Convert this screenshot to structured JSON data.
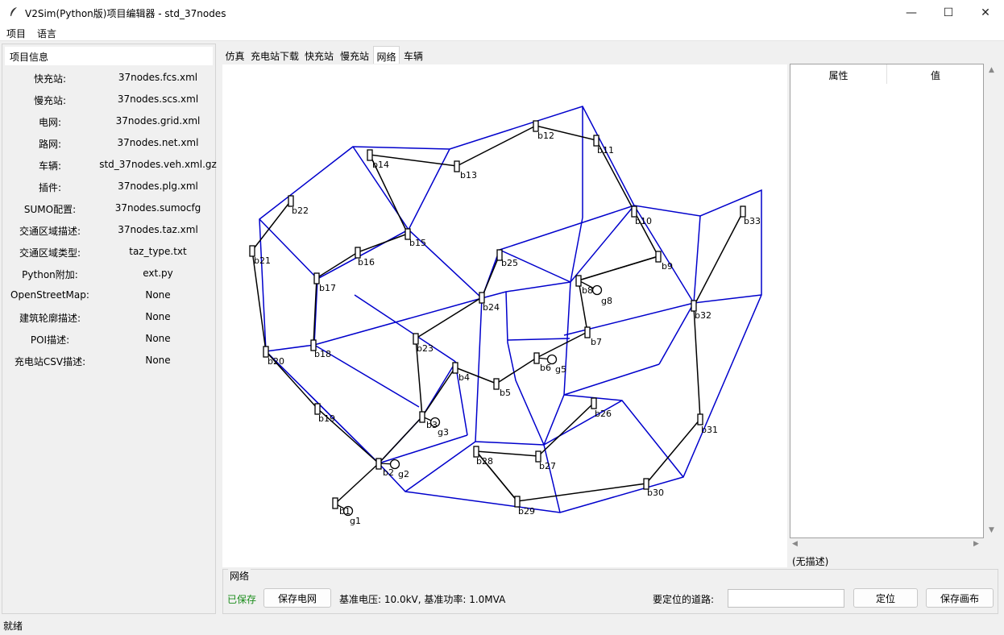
{
  "window": {
    "title": "V2Sim(Python版)项目编辑器 - std_37nodes",
    "minimize": "—",
    "maximize": "☐",
    "close": "✕"
  },
  "menu": [
    "项目",
    "语言"
  ],
  "project_info": {
    "header": "项目信息",
    "rows": [
      {
        "key": "快充站:",
        "value": "37nodes.fcs.xml"
      },
      {
        "key": "慢充站:",
        "value": "37nodes.scs.xml"
      },
      {
        "key": "电网:",
        "value": "37nodes.grid.xml"
      },
      {
        "key": "路网:",
        "value": "37nodes.net.xml"
      },
      {
        "key": "车辆:",
        "value": "std_37nodes.veh.xml.gz"
      },
      {
        "key": "插件:",
        "value": "37nodes.plg.xml"
      },
      {
        "key": "SUMO配置:",
        "value": "37nodes.sumocfg"
      },
      {
        "key": "交通区域描述:",
        "value": "37nodes.taz.xml"
      },
      {
        "key": "交通区域类型:",
        "value": "taz_type.txt"
      },
      {
        "key": "Python附加:",
        "value": "ext.py"
      },
      {
        "key": "OpenStreetMap:",
        "value": "None"
      },
      {
        "key": "建筑轮廓描述:",
        "value": "None"
      },
      {
        "key": "POI描述:",
        "value": "None"
      },
      {
        "key": "充电站CSV描述:",
        "value": "None"
      }
    ]
  },
  "tabs": [
    "仿真",
    "充电站下载",
    "快充站",
    "慢充站",
    "网络",
    "车辆"
  ],
  "active_tab": "网络",
  "properties": {
    "col_attr": "属性",
    "col_value": "值",
    "description": "(无描述)"
  },
  "network_group": {
    "label": "网络",
    "saved_status": "已保存",
    "save_grid_button": "保存电网",
    "base_info": "基准电压: 10.0kV, 基准功率: 1.0MVA",
    "locate_label": "要定位的道路:",
    "locate_value": "",
    "locate_button": "定位",
    "save_canvas_button": "保存画布"
  },
  "status": "就绪",
  "colors": {
    "road": "#0000cc",
    "line": "#000000",
    "saved": "#1a8c1a"
  },
  "network": {
    "buses": [
      "b1",
      "b2",
      "b3",
      "b4",
      "b5",
      "b6",
      "b7",
      "b8",
      "b9",
      "b10",
      "b11",
      "b12",
      "b13",
      "b14",
      "b15",
      "b16",
      "b17",
      "b18",
      "b19",
      "b20",
      "b21",
      "b22",
      "b23",
      "b24",
      "b25",
      "b26",
      "b27",
      "b28",
      "b29",
      "b30",
      "b31",
      "b32",
      "b33"
    ],
    "generators": [
      "g1",
      "g2",
      "g3",
      "g5",
      "g8"
    ]
  }
}
